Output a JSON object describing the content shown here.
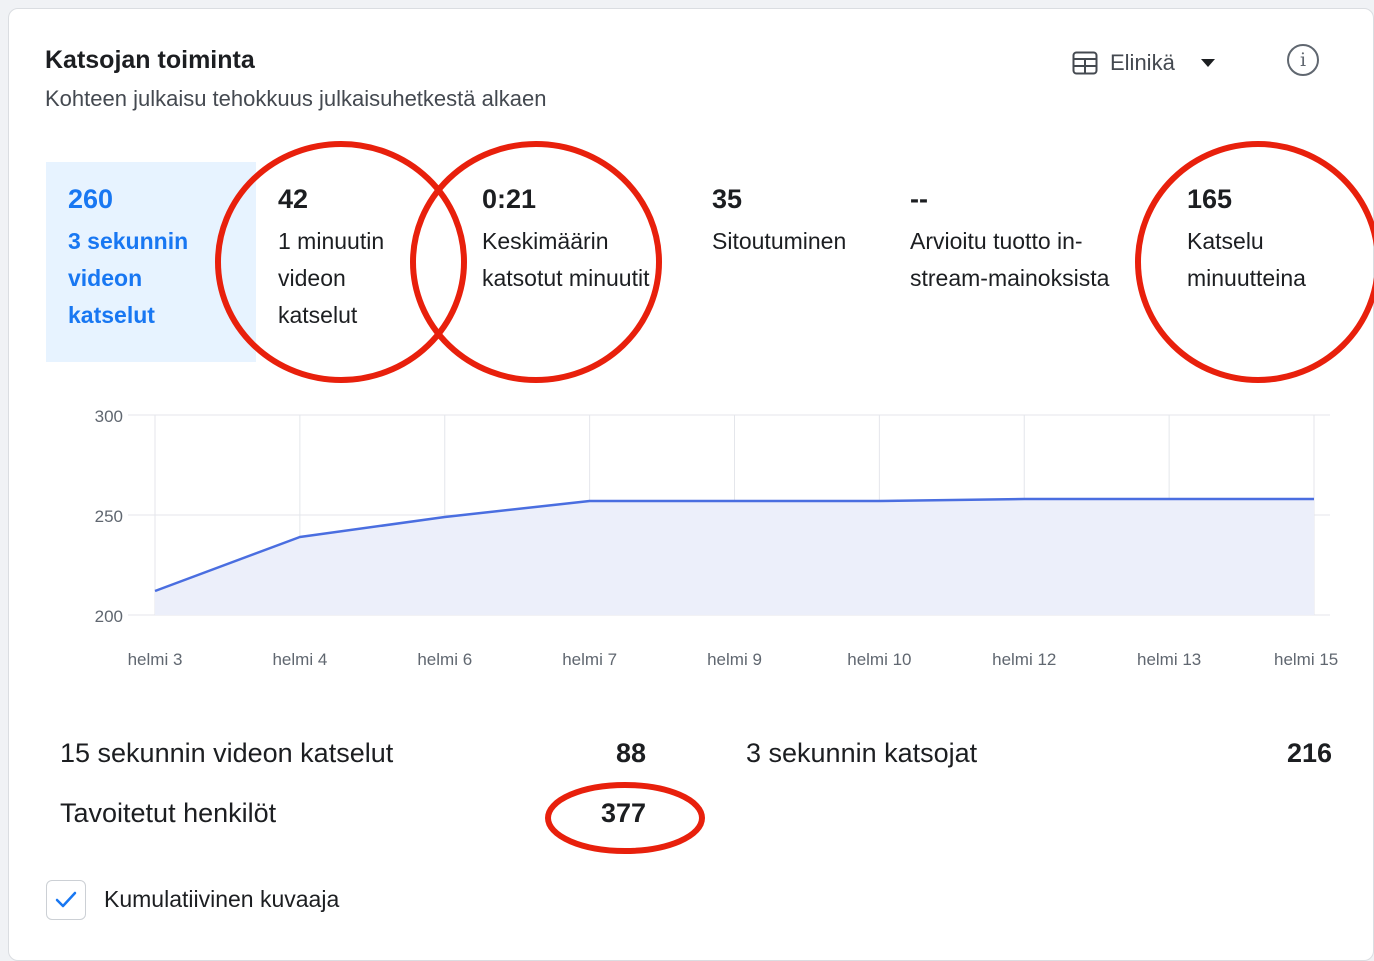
{
  "header": {
    "title": "Katsojan toiminta",
    "subtitle": "Kohteen julkaisu tehokkuus julkaisuhetkestä alkaen",
    "range_label": "Elinikä",
    "info_glyph": "i"
  },
  "metrics": [
    {
      "value": "260",
      "label": "3 sekunnin videon katselut",
      "selected": true
    },
    {
      "value": "42",
      "label": "1 minuutin videon katselut",
      "selected": false
    },
    {
      "value": "0:21",
      "label": "Keskimäärin katsotut minuutit",
      "selected": false
    },
    {
      "value": "35",
      "label": "Sitoutuminen",
      "selected": false
    },
    {
      "value": "--",
      "label": "Arvioitu tuotto in-stream-mainoksista",
      "selected": false
    },
    {
      "value": "165",
      "label": "Katselu minuutteina",
      "selected": false
    }
  ],
  "chart_data": {
    "type": "area",
    "title": "",
    "xlabel": "",
    "ylabel": "",
    "ylim": [
      200,
      300
    ],
    "y_ticks": [
      "300",
      "250",
      "200"
    ],
    "x_ticks": [
      "helmi 3",
      "helmi 4",
      "helmi 6",
      "helmi 7",
      "helmi 9",
      "helmi 10",
      "helmi 12",
      "helmi 13",
      "helmi 15"
    ],
    "series": [
      {
        "values": [
          212,
          239,
          249,
          257,
          257,
          257,
          258,
          258,
          258
        ]
      }
    ],
    "grid": true,
    "line_color": "#4a6ee0",
    "fill_color": "#eceffa"
  },
  "stats": {
    "views_15s_label": "15 sekunnin videon katselut",
    "views_15s_value": "88",
    "viewers_3s_label": "3 sekunnin katsojat",
    "viewers_3s_value": "216",
    "reach_label": "Tavoitetut henkilöt",
    "reach_value": "377"
  },
  "cumulative": {
    "label": "Kumulatiivinen kuvaaja",
    "checked": true
  },
  "colors": {
    "accent": "#1877f2",
    "annotation": "#e8200c",
    "selected_bg": "#e7f3ff"
  }
}
